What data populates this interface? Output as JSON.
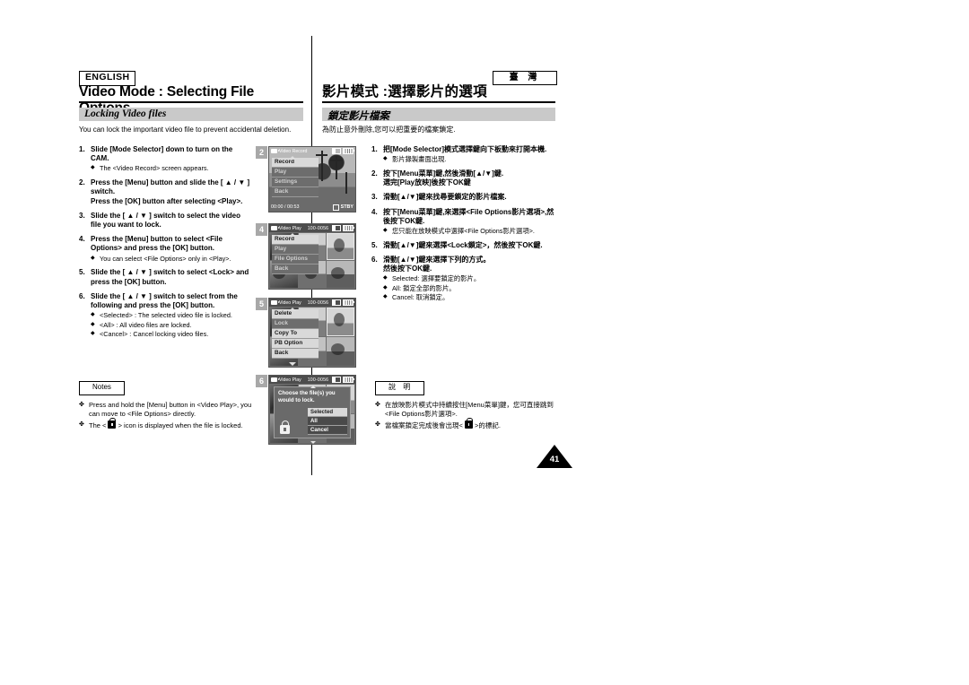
{
  "header": {
    "english_badge": "ENGLISH",
    "locale_badge": "臺 灣",
    "title_en": "Video Mode : Selecting File Options",
    "title_cn": "影片模式 :選擇影片的選項"
  },
  "section": {
    "heading_en": "Locking Video files",
    "heading_cn": "鎖定影片檔案",
    "lead_en": "You can lock the important video file to prevent accidental deletion.",
    "lead_cn": "為防止意外刪除,您可以把重要的檔案鎖定."
  },
  "steps_en": [
    {
      "num": "1.",
      "text": "Slide [Mode Selector] down to turn on the CAM.",
      "subs": [
        "The <Video Record> screen appears."
      ]
    },
    {
      "num": "2.",
      "text": "Press the [Menu] button and slide the [ ▲ / ▼ ] switch.\nPress the [OK] button after selecting <Play>.",
      "subs": []
    },
    {
      "num": "3.",
      "text": "Slide the [ ▲ / ▼ ] switch to select the video file you want to lock.",
      "subs": []
    },
    {
      "num": "4.",
      "text": "Press the [Menu] button to select <File Options> and press the [OK] button.",
      "subs": [
        "You can select <File Options> only in <Play>."
      ]
    },
    {
      "num": "5.",
      "text": "Slide the [ ▲ / ▼ ] switch to select <Lock> and press the [OK] button.",
      "subs": []
    },
    {
      "num": "6.",
      "text": "Slide the [ ▲ / ▼ ] switch to select from the following and press the [OK] button.",
      "subs": [
        "<Selected> : The selected video file is locked.",
        "<All> : All video files are locked.",
        "<Cancel> : Cancel locking video files."
      ]
    }
  ],
  "steps_cn": [
    {
      "num": "1.",
      "text": "把[Mode Selector]模式選擇鍵向下板動來打開本機.",
      "subs": [
        "影片錄製畫面出現."
      ]
    },
    {
      "num": "2.",
      "text": "按下[Menu菜單]鍵,然後滑動[▲/▼]鍵.\n選完[Play放映]後按下OK鍵",
      "subs": []
    },
    {
      "num": "3.",
      "text": "滑動[▲/▼]鍵來找尋要鎖定的影片檔案.",
      "subs": []
    },
    {
      "num": "4.",
      "text": "按下[Menu菜單]鍵,來選擇<File Options影片選項>,然後按下OK鍵.",
      "subs": [
        "您只能在放映模式中選擇<File Options影片選項>."
      ]
    },
    {
      "num": "5.",
      "text": "滑動[▲/▼]鍵來選擇<Lock鎖定>，然後按下OK鍵.",
      "subs": []
    },
    {
      "num": "6.",
      "text": "滑動[▲/▼]鍵來選擇下列的方式。\n然後按下OK鍵.",
      "subs": [
        "Selected: 選擇要鎖定的影片。",
        "All: 鎖定全部的影片。",
        "Cancel: 取消鎖定。"
      ]
    }
  ],
  "notes_en": {
    "label": "Notes",
    "items": [
      "Press and hold the [Menu] button in <Video Play>, you can move to <File Options> directly.",
      "The <  > icon is displayed when the file is locked."
    ]
  },
  "notes_cn": {
    "label": "說 明",
    "items": [
      "在放映影片模式中持續按住[Menu菜單]鍵，您可直接跳到<File Options影片選項>.",
      "當檔案鎖定完成後會出現<  >的標記."
    ]
  },
  "page_number": "41",
  "panels": [
    {
      "num": "2",
      "lcd_title": "Video Record",
      "lcd_fileno": "",
      "menu": [
        {
          "label": "Record",
          "state": "sel"
        },
        {
          "label": "Play",
          "state": "dim"
        },
        {
          "label": "Settings",
          "state": "dim"
        },
        {
          "label": "Back",
          "state": "dim"
        }
      ],
      "time_counter": "00:00 / 00:53",
      "status": "STBY"
    },
    {
      "num": "4",
      "lcd_title": "Video Play",
      "lcd_fileno": "100-0056",
      "menu": [
        {
          "label": "Record",
          "state": "sel"
        },
        {
          "label": "Play",
          "state": "dim"
        },
        {
          "label": "File Options",
          "state": "dim"
        },
        {
          "label": "Back",
          "state": "dim"
        }
      ]
    },
    {
      "num": "5",
      "lcd_title": "Video Play",
      "lcd_fileno": "100-0056",
      "menu": [
        {
          "label": "Delete",
          "state": "sel"
        },
        {
          "label": "Lock",
          "state": "dim"
        },
        {
          "label": "Copy To",
          "state": "sel"
        },
        {
          "label": "PB Option",
          "state": "sel"
        },
        {
          "label": "Back",
          "state": "sel"
        }
      ]
    },
    {
      "num": "6",
      "lcd_title": "Video Play",
      "lcd_fileno": "100-0056",
      "dialog": {
        "message": "Choose the file(s) you would to lock.",
        "buttons": [
          {
            "label": "Selected",
            "state": "sel"
          },
          {
            "label": "All",
            "state": "normal"
          },
          {
            "label": "Cancel",
            "state": "normal"
          }
        ]
      }
    }
  ]
}
